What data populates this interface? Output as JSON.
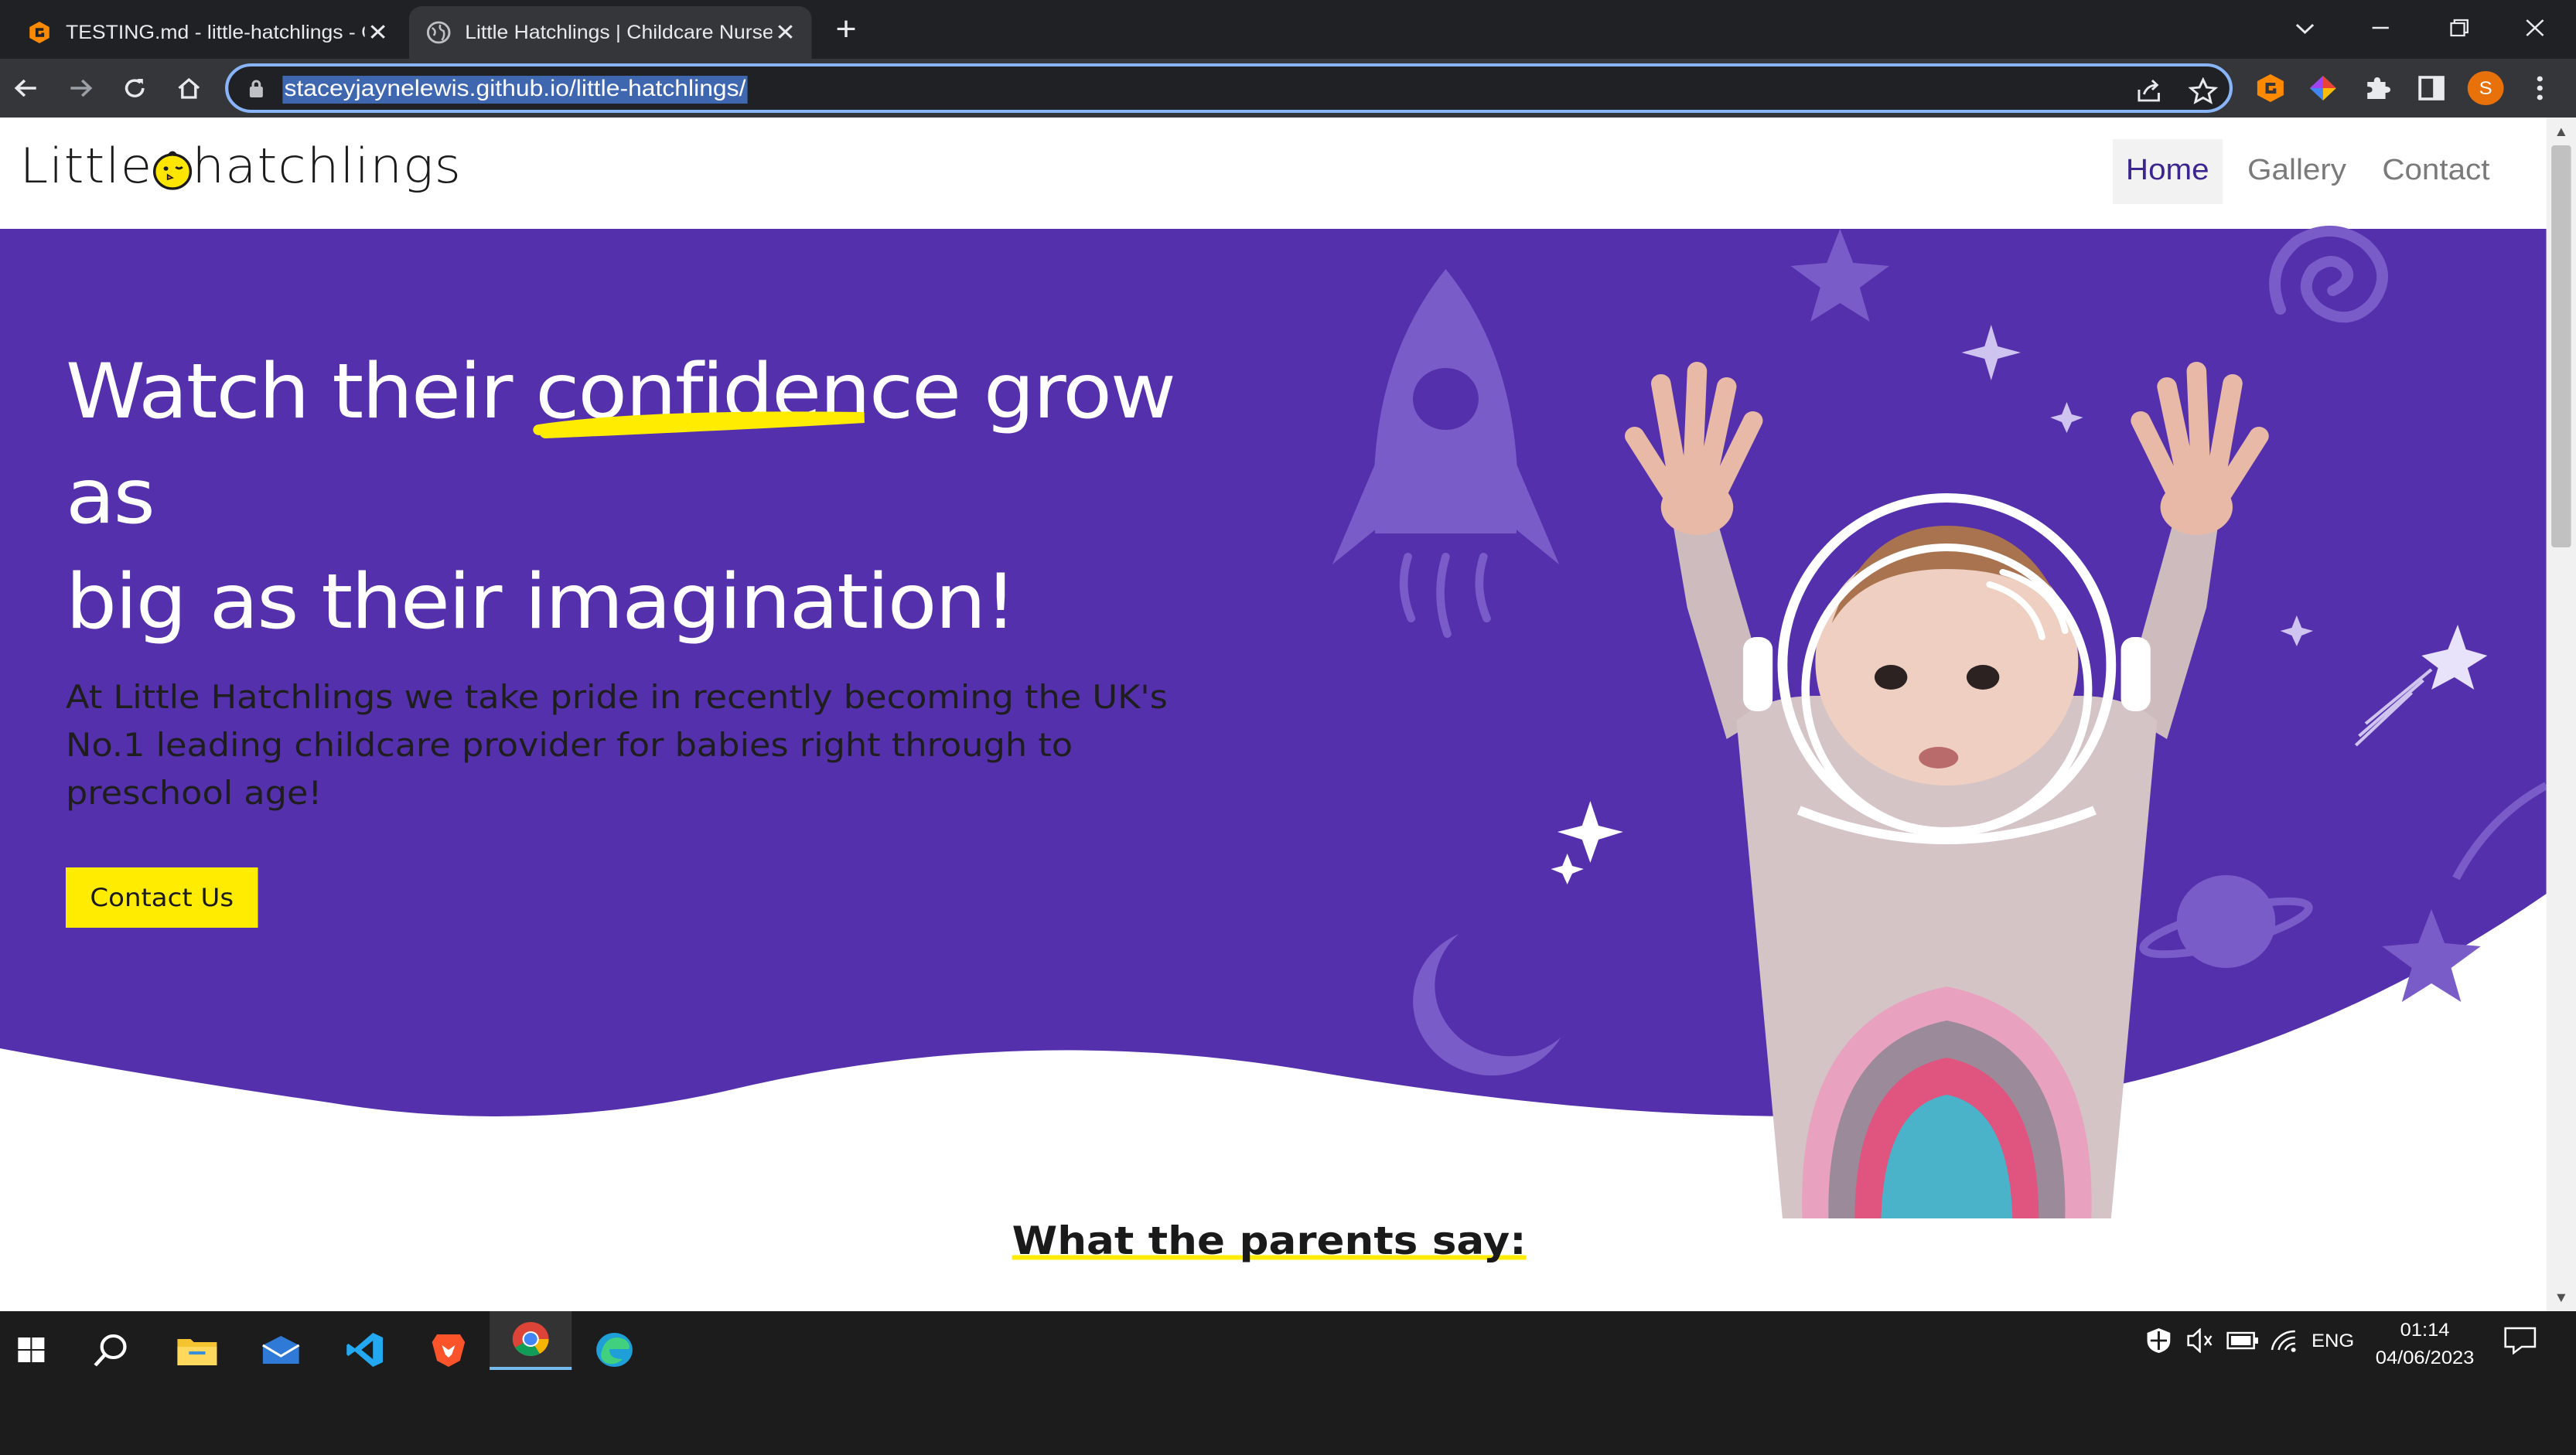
{
  "browser": {
    "tabs": [
      {
        "title": "TESTING.md - little-hatchlings - G",
        "active": false
      },
      {
        "title": "Little Hatchlings | Childcare Nurse",
        "active": true
      }
    ],
    "url": "staceyjaynelewis.github.io/little-hatchlings/",
    "profile_initial": "S"
  },
  "site": {
    "logo": {
      "part1": "Little",
      "part2": "hatchlings"
    },
    "nav": [
      {
        "label": "Home",
        "active": true
      },
      {
        "label": "Gallery",
        "active": false
      },
      {
        "label": "Contact",
        "active": false
      }
    ],
    "hero": {
      "title_before": "Watch their",
      "title_highlight": "confidence",
      "title_after": "grow as",
      "title_line2": "big as their imagination!",
      "text": "At Little Hatchlings we take pride in recently becoming the UK's No.1 leading childcare provider for babies right through to preschool age!",
      "cta_label": "Contact Us"
    },
    "testimonials_title": "What the parents say:"
  },
  "colors": {
    "hero_purple": "#5530ad",
    "accent_yellow": "#ffec00",
    "nav_active": "#3d2590"
  },
  "taskbar": {
    "language": "ENG",
    "time": "01:14",
    "date": "04/06/2023"
  }
}
